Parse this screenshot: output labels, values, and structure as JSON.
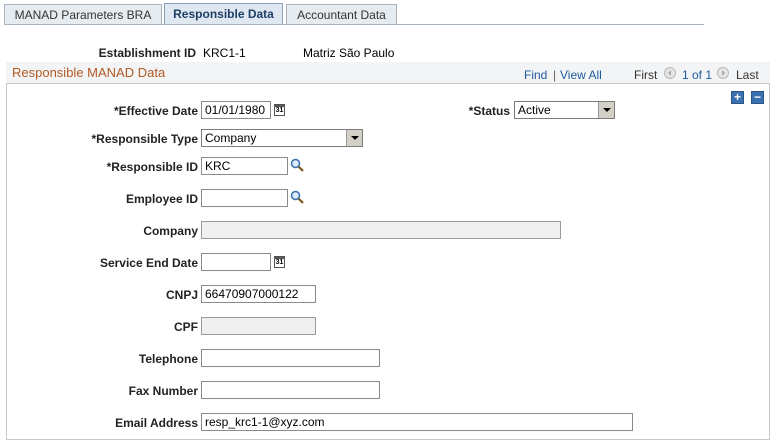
{
  "tabs": [
    {
      "label": "MANAD Parameters BRA",
      "active": false
    },
    {
      "label": "Responsible Data",
      "active": true
    },
    {
      "label": "Accountant Data",
      "active": false
    }
  ],
  "establishment": {
    "label": "Establishment ID",
    "id": "KRC1-1",
    "description": "Matriz São Paulo"
  },
  "section": {
    "title": "Responsible MANAD Data",
    "find": "Find",
    "separator": "|",
    "view_all": "View All",
    "first": "First",
    "range": "1 of 1",
    "last": "Last",
    "add": "+",
    "remove": "−"
  },
  "form": {
    "effective_date": {
      "label": "*Effective Date",
      "value": "01/01/1980"
    },
    "status": {
      "label": "*Status",
      "value": "Active"
    },
    "responsible_type": {
      "label": "*Responsible Type",
      "value": "Company"
    },
    "responsible_id": {
      "label": "*Responsible ID",
      "value": "KRC"
    },
    "employee_id": {
      "label": "Employee ID",
      "value": ""
    },
    "company": {
      "label": "Company",
      "value": ""
    },
    "service_end_date": {
      "label": "Service End Date",
      "value": ""
    },
    "cnpj": {
      "label": "CNPJ",
      "value": "66470907000122"
    },
    "cpf": {
      "label": "CPF",
      "value": ""
    },
    "telephone": {
      "label": "Telephone",
      "value": ""
    },
    "fax_number": {
      "label": "Fax Number",
      "value": ""
    },
    "email_address": {
      "label": "Email Address",
      "value": "resp_krc1-1@xyz.com"
    }
  },
  "icons": {
    "calendar": "calendar-icon",
    "lookup": "magnifier-icon",
    "prev": "previous-arrow-icon",
    "next": "next-arrow-icon"
  },
  "colors": {
    "section_title": "#b35a24",
    "link": "#1f5a9c",
    "button_blue": "#3a6fb0"
  }
}
